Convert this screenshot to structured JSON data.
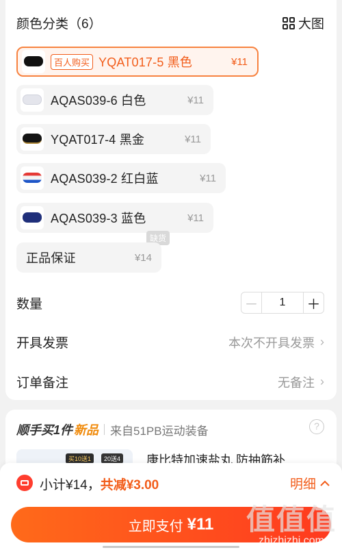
{
  "colors": {
    "accent": "#f25c19",
    "pay_gradient_start": "#ff6a1a",
    "pay_gradient_end": "#ff3a1f"
  },
  "variants": {
    "title": "颜色分类（6）",
    "view_toggle_label": "大图",
    "options": [
      {
        "tag": "百人购买",
        "name": "YQAT017-5 黑色",
        "price": "¥11",
        "selected": true,
        "color": "#111111"
      },
      {
        "name": "AQAS039-6 白色",
        "price": "¥11",
        "color": "#e8e9ef"
      },
      {
        "name": "YQAT017-4 黑金",
        "price": "¥11",
        "color": "#141414"
      },
      {
        "name": "AQAS039-2 红白蓝",
        "price": "¥11",
        "color": "#f0f0f0"
      },
      {
        "name": "AQAS039-3 蓝色",
        "price": "¥11",
        "color": "#1f2f7a"
      },
      {
        "name": "正品保证",
        "price": "¥14",
        "badge": "缺货"
      }
    ]
  },
  "quantity": {
    "label": "数量",
    "value": "1",
    "minus": "－",
    "plus": "＋"
  },
  "invoice": {
    "label": "开具发票",
    "value": "本次不开具发票"
  },
  "remark": {
    "label": "订单备注",
    "value": "无备注"
  },
  "addon": {
    "title": "顺手买1件",
    "new_label": "新品",
    "source": "来自51PB运动装备",
    "help": "?",
    "promo_1": "买10送1",
    "promo_2": "20送4",
    "product_name": "康比特加速盐丸 防抽筋补"
  },
  "summary": {
    "subtotal_label": "小计¥14，",
    "savings_label": "共减¥3.00",
    "detail_label": "明细",
    "pay_label": "立即支付",
    "pay_amount": "¥11"
  },
  "watermark": {
    "big": "值值值",
    "small": "zhizhizhi.com"
  }
}
